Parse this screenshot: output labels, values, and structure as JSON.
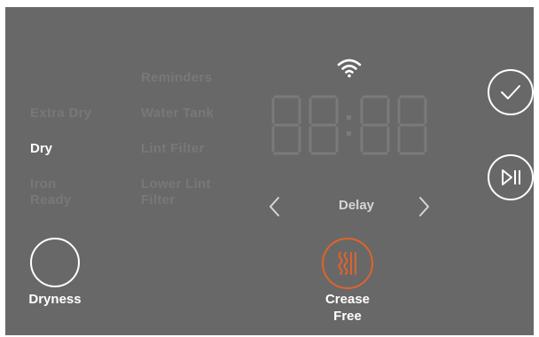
{
  "cycle_options": {
    "extra_dry": "Extra Dry",
    "dry": "Dry",
    "iron_ready": "Iron\nReady"
  },
  "indicators": {
    "reminders": "Reminders",
    "water_tank": "Water Tank",
    "lint_filter": "Lint Filter",
    "lower_lint_filter": "Lower Lint\nFilter"
  },
  "display": {
    "digits": "88:88",
    "delay_label": "Delay"
  },
  "buttons": {
    "dryness_label": "Dryness",
    "crease_free_label": "Crease\nFree"
  },
  "colors": {
    "panel": "#686868",
    "dim_text": "#787878",
    "active_text": "#ffffff",
    "accent": "#e0632a",
    "segment_off": "#7a7a7a"
  },
  "icons": {
    "wifi": "wifi-icon",
    "confirm": "checkmark-icon",
    "start": "play-pause-icon",
    "crease_free": "steam-wave-icon",
    "prev": "chevron-left-icon",
    "next": "chevron-right-icon"
  }
}
